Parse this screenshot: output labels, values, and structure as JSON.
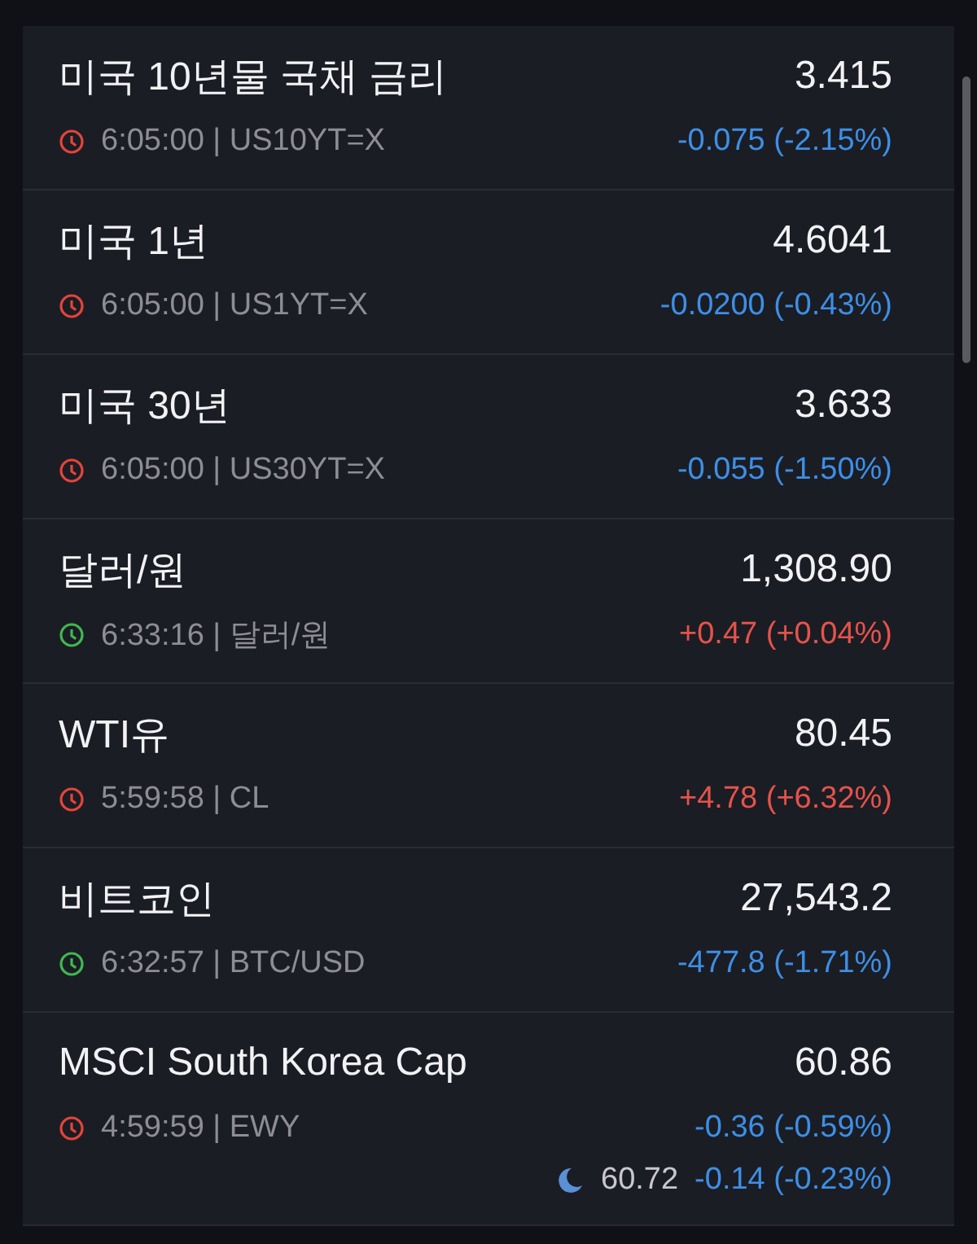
{
  "quotes": [
    {
      "name": "미국 10년물 국채 금리",
      "price": "3.415",
      "market_open": false,
      "info": "6:05:00 | US10YT=X",
      "change": "-0.075 (-2.15%)",
      "rising": false
    },
    {
      "name": "미국 1년",
      "price": "4.6041",
      "market_open": false,
      "info": "6:05:00 | US1YT=X",
      "change": "-0.0200 (-0.43%)",
      "rising": false
    },
    {
      "name": "미국 30년",
      "price": "3.633",
      "market_open": false,
      "info": "6:05:00 | US30YT=X",
      "change": "-0.055 (-1.50%)",
      "rising": false
    },
    {
      "name": "달러/원",
      "price": "1,308.90",
      "market_open": true,
      "info": "6:33:16 | 달러/원",
      "change": "+0.47 (+0.04%)",
      "rising": true
    },
    {
      "name": "WTI유",
      "price": "80.45",
      "market_open": false,
      "info": "5:59:58 | CL",
      "change": "+4.78 (+6.32%)",
      "rising": true
    },
    {
      "name": "비트코인",
      "price": "27,543.2",
      "market_open": true,
      "info": "6:32:57 | BTC/USD",
      "change": "-477.8 (-1.71%)",
      "rising": false
    },
    {
      "name": "MSCI South Korea Cap",
      "price": "60.86",
      "market_open": false,
      "info": "4:59:59 | EWY",
      "change": "-0.36 (-0.59%)",
      "rising": false,
      "after_hours": {
        "price": "60.72",
        "change": "-0.14 (-0.23%)",
        "rising": false
      }
    }
  ]
}
